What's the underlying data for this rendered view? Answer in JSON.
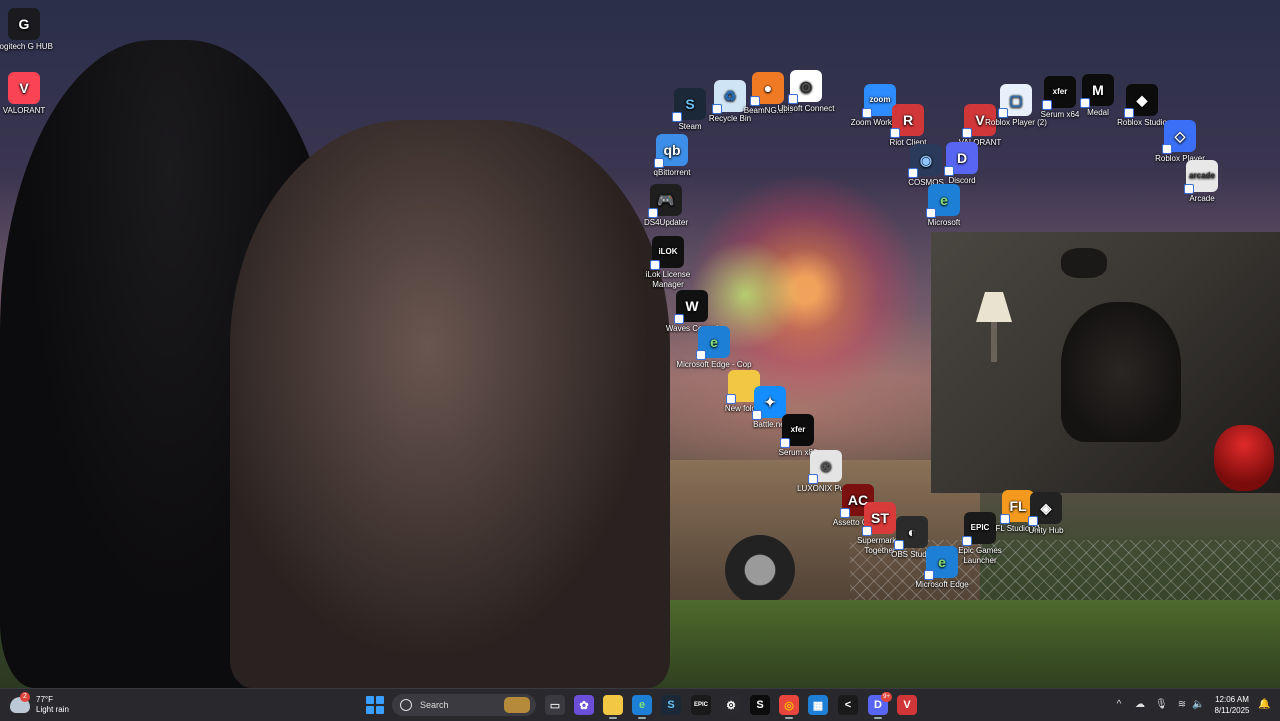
{
  "desktop_icons": [
    {
      "label": "Logitech G HUB",
      "glyph": "G",
      "bg": "#1b1b1f",
      "color": "#ffffff"
    },
    {
      "label": "VALORANT",
      "glyph": "V",
      "bg": "#fa4454",
      "color": "#ffffff"
    },
    {
      "label": "Steam",
      "glyph": "S",
      "bg": "#1b2838",
      "color": "#66c0f4"
    },
    {
      "label": "Recycle Bin",
      "glyph": "♻",
      "bg": "#cfe4f5",
      "color": "#2a6fb5"
    },
    {
      "label": "BeamNG.dr...",
      "glyph": "●",
      "bg": "#f07a24",
      "color": "#ffffff"
    },
    {
      "label": "Ubisoft Connect",
      "glyph": "◎",
      "bg": "#ffffff",
      "color": "#2a2a2a"
    },
    {
      "label": "Zoom Workpla...",
      "glyph": "zoom",
      "bg": "#2d8cff",
      "color": "#ffffff"
    },
    {
      "label": "Riot Client",
      "glyph": "R",
      "bg": "#d13639",
      "color": "#ffffff"
    },
    {
      "label": "VALORANT",
      "glyph": "V",
      "bg": "#d13639",
      "color": "#ffffff"
    },
    {
      "label": "Roblox Player (2)",
      "glyph": "▢",
      "bg": "#e8f1fb",
      "color": "#2a6fb5"
    },
    {
      "label": "Serum x64",
      "glyph": "xfer",
      "bg": "#0c0c0c",
      "color": "#ffffff"
    },
    {
      "label": "Medal",
      "glyph": "M",
      "bg": "#0c0c0c",
      "color": "#ffffff"
    },
    {
      "label": "Roblox Studio",
      "glyph": "◆",
      "bg": "#0c0c0c",
      "color": "#ffffff"
    },
    {
      "label": "Roblox Player",
      "glyph": "◇",
      "bg": "#3b6ff5",
      "color": "#ffffff"
    },
    {
      "label": "qBittorrent",
      "glyph": "qb",
      "bg": "#3d8ee6",
      "color": "#ffffff"
    },
    {
      "label": "COSMOS",
      "glyph": "◉",
      "bg": "#2a3a5a",
      "color": "#8fc6ff"
    },
    {
      "label": "Discord",
      "glyph": "D",
      "bg": "#5865f2",
      "color": "#ffffff"
    },
    {
      "label": "Arcade",
      "glyph": "arcade",
      "bg": "#e8e8e8",
      "color": "#333333"
    },
    {
      "label": "DS4Updater",
      "glyph": "🎮",
      "bg": "#1f1f1f",
      "color": "#ffffff"
    },
    {
      "label": "Microsoft",
      "glyph": "e",
      "bg": "#1e7fd6",
      "color": "#7fe07a"
    },
    {
      "label": "iLok License Manager",
      "glyph": "iLOK",
      "bg": "#111111",
      "color": "#ffffff"
    },
    {
      "label": "Waves Central",
      "glyph": "W",
      "bg": "#111111",
      "color": "#ffffff"
    },
    {
      "label": "Microsoft Edge - Cop",
      "glyph": "e",
      "bg": "#1e7fd6",
      "color": "#7fe07a"
    },
    {
      "label": "New folder",
      "glyph": "",
      "bg": "#f2c744",
      "color": "#f2c744"
    },
    {
      "label": "Battle.net",
      "glyph": "✦",
      "bg": "#148eff",
      "color": "#ffffff"
    },
    {
      "label": "Serum x86",
      "glyph": "xfer",
      "bg": "#0c0c0c",
      "color": "#ffffff"
    },
    {
      "label": "LUXONIX Purity",
      "glyph": "⊘",
      "bg": "#e4e4e4",
      "color": "#555555"
    },
    {
      "label": "Assetto Corsa",
      "glyph": "AC",
      "bg": "#7a1010",
      "color": "#ffffff"
    },
    {
      "label": "Supermarket Together",
      "glyph": "ST",
      "bg": "#d93a3a",
      "color": "#ffffff"
    },
    {
      "label": "OBS Studio",
      "glyph": "◐",
      "bg": "#2b2b2b",
      "color": "#ffffff"
    },
    {
      "label": "Microsoft Edge",
      "glyph": "e",
      "bg": "#1e7fd6",
      "color": "#7fe07a"
    },
    {
      "label": "Epic Games Launcher",
      "glyph": "EPIC",
      "bg": "#1a1a1a",
      "color": "#ffffff"
    },
    {
      "label": "FL Studio 21",
      "glyph": "FL",
      "bg": "#f39a1e",
      "color": "#ffffff"
    },
    {
      "label": "Unity Hub",
      "glyph": "◈",
      "bg": "#222222",
      "color": "#ffffff"
    }
  ],
  "taskbar": {
    "weather": {
      "temp": "77°F",
      "condition": "Light rain",
      "badge": "2"
    },
    "search_placeholder": "Search",
    "apps": [
      {
        "name": "task-view",
        "glyph": "▭",
        "bg": "#3a3a40",
        "color": "#ddd"
      },
      {
        "name": "copilot",
        "glyph": "✿",
        "bg": "#6b4fd8",
        "color": "#fff"
      },
      {
        "name": "file-explorer",
        "glyph": "▬",
        "bg": "#f2c744",
        "color": "#f2c744"
      },
      {
        "name": "edge",
        "glyph": "e",
        "bg": "#1e7fd6",
        "color": "#7fe07a"
      },
      {
        "name": "steam",
        "glyph": "S",
        "bg": "#1b2838",
        "color": "#66c0f4"
      },
      {
        "name": "epic",
        "glyph": "EPIC",
        "bg": "#1a1a1a",
        "color": "#fff"
      },
      {
        "name": "settings",
        "glyph": "⚙",
        "bg": "#2a2a2e",
        "color": "#fff"
      },
      {
        "name": "serum",
        "glyph": "S",
        "bg": "#0c0c0c",
        "color": "#fff"
      },
      {
        "name": "chrome",
        "glyph": "◎",
        "bg": "#e8453c",
        "color": "#fbbc05"
      },
      {
        "name": "microsoft-store",
        "glyph": "▦",
        "bg": "#1e7fd6",
        "color": "#fff"
      },
      {
        "name": "capcut",
        "glyph": "<",
        "bg": "#1a1a1a",
        "color": "#fff"
      },
      {
        "name": "discord",
        "glyph": "D",
        "bg": "#5865f2",
        "color": "#fff"
      },
      {
        "name": "valorant",
        "glyph": "V",
        "bg": "#d13639",
        "color": "#fff"
      }
    ],
    "discord_badge": "9+",
    "tray": {
      "chevron": "^",
      "time": "12:06 AM",
      "date": "8/11/2025"
    }
  }
}
